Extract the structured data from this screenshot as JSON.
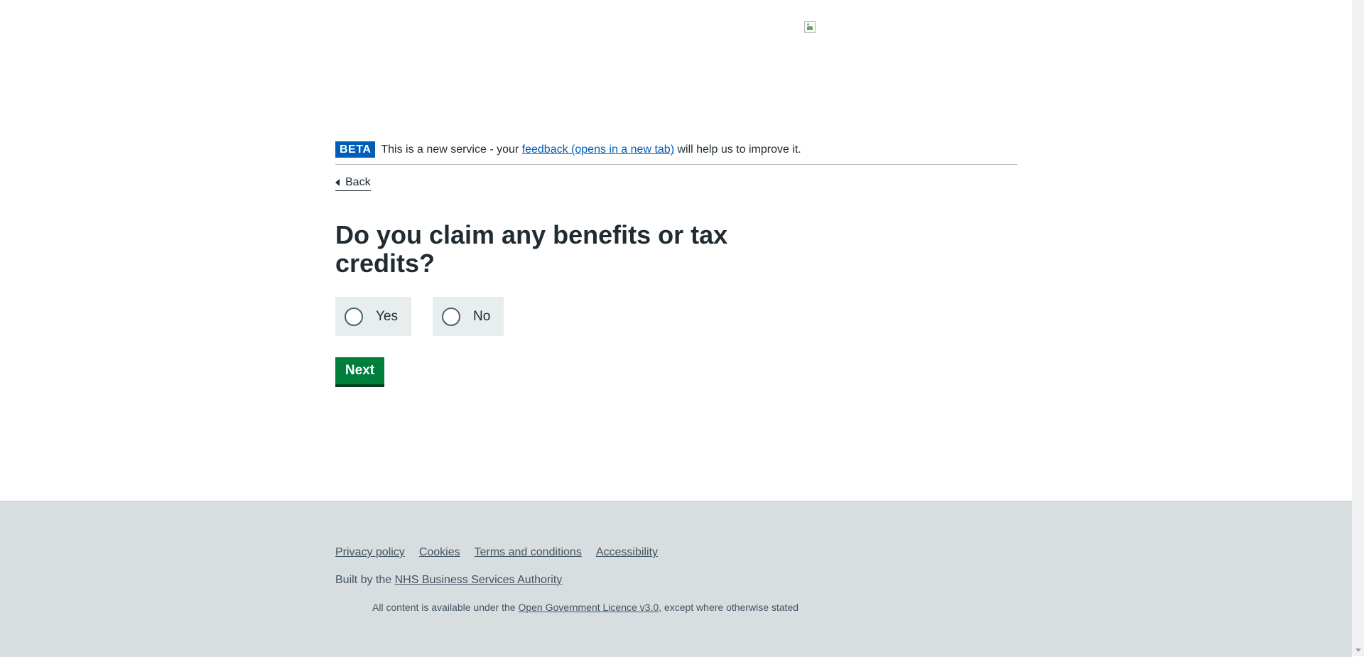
{
  "phase_banner": {
    "tag": "BETA",
    "text_before": "This is a new service - your ",
    "link": "feedback (opens in a new tab)",
    "text_after": " will help us to improve it."
  },
  "back_link": "Back",
  "question": {
    "heading": "Do you claim any benefits or tax credits?",
    "options": [
      {
        "label": "Yes",
        "selected": false
      },
      {
        "label": "No",
        "selected": false
      }
    ]
  },
  "next_button": "Next",
  "footer": {
    "links": [
      "Privacy policy",
      "Cookies",
      "Terms and conditions",
      "Accessibility"
    ],
    "built_by_prefix": "Built by the ",
    "built_by_link": "NHS Business Services Authority",
    "licence_prefix": "All content is available under the ",
    "licence_link": "Open Government Licence v3.0",
    "licence_suffix": ", except where otherwise stated"
  },
  "colors": {
    "primary_blue": "#005eb8",
    "button_green": "#007f3b",
    "radio_bg": "#e8edee",
    "footer_bg": "#d8dde0",
    "text": "#212b32"
  }
}
